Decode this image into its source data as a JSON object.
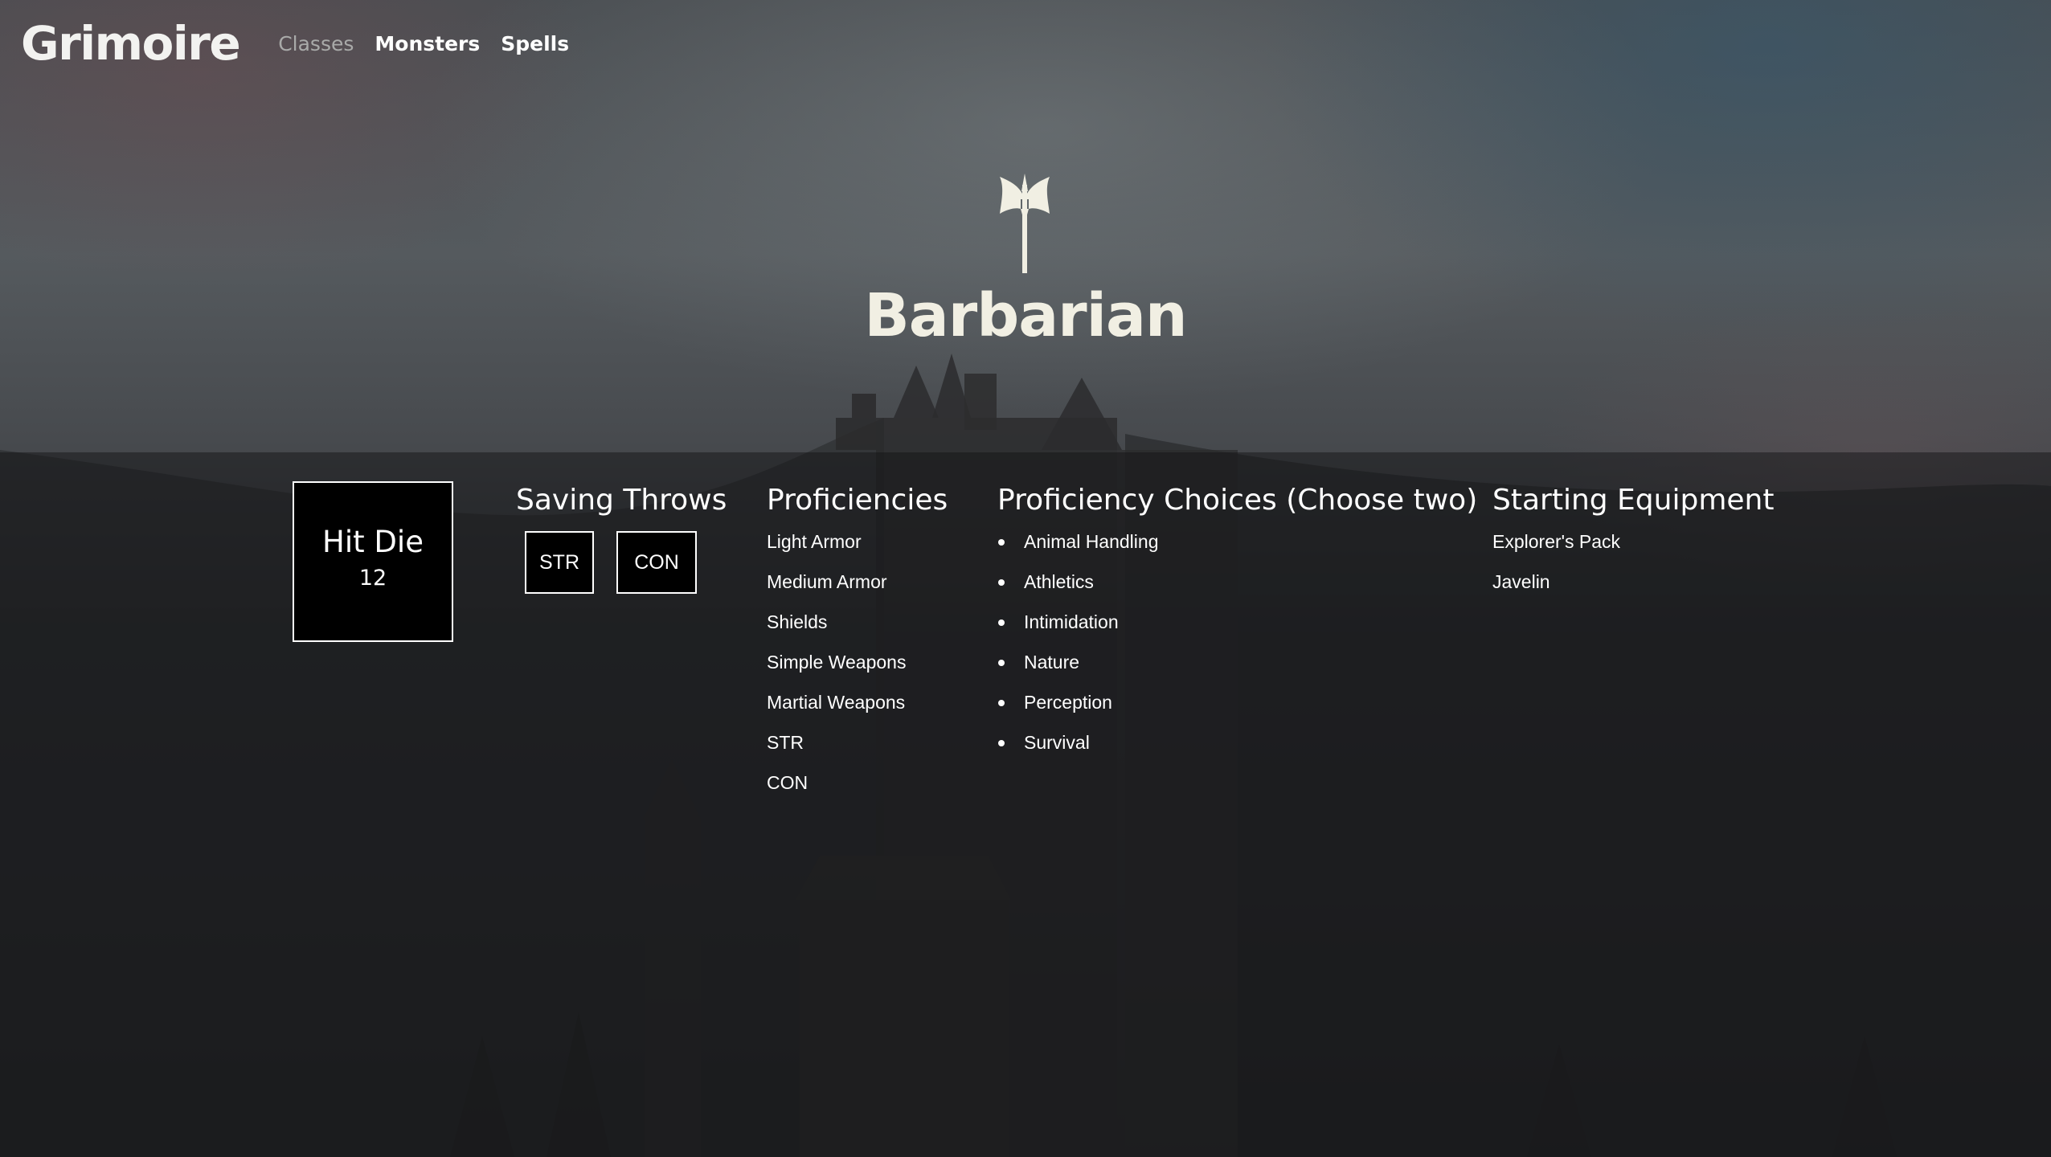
{
  "brand": "Grimoire",
  "nav": {
    "items": [
      {
        "label": "Classes"
      },
      {
        "label": "Monsters"
      },
      {
        "label": "Spells"
      }
    ]
  },
  "hero": {
    "icon": "battle-axe-icon",
    "title": "Barbarian"
  },
  "hit_die": {
    "label": "Hit Die",
    "value": "12"
  },
  "saving_throws": {
    "heading": "Saving Throws",
    "items": [
      "STR",
      "CON"
    ]
  },
  "proficiencies": {
    "heading": "Proficiencies",
    "items": [
      "Light Armor",
      "Medium Armor",
      "Shields",
      "Simple Weapons",
      "Martial Weapons",
      "STR",
      "CON"
    ]
  },
  "proficiency_choices": {
    "heading": "Proficiency Choices (Choose two)",
    "items": [
      "Animal Handling",
      "Athletics",
      "Intimidation",
      "Nature",
      "Perception",
      "Survival"
    ]
  },
  "starting_equipment": {
    "heading": "Starting Equipment",
    "items": [
      "Explorer's Pack",
      "Javelin"
    ]
  },
  "colors": {
    "accent": "#f1efe3",
    "nav_muted": "#a9aaa9"
  }
}
